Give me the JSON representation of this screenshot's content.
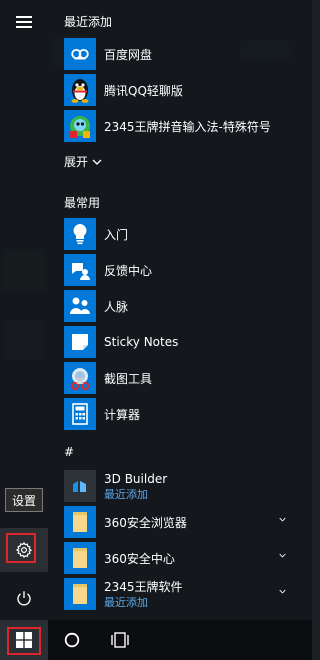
{
  "menu": {
    "recent_header": "最近添加",
    "recent": [
      {
        "label": "百度网盘",
        "icon": "baidu-netdisk-icon"
      },
      {
        "label": "腾讯QQ轻聊版",
        "icon": "qq-penguin-icon"
      },
      {
        "label": "2345王牌拼音输入法-特殊符号",
        "icon": "input-method-icon"
      }
    ],
    "expand_label": "展开",
    "frequent_header": "最常用",
    "frequent": [
      {
        "label": "入门",
        "icon": "lightbulb-icon"
      },
      {
        "label": "反馈中心",
        "icon": "feedback-icon"
      },
      {
        "label": "人脉",
        "icon": "people-icon"
      },
      {
        "label": "Sticky Notes",
        "icon": "sticky-note-icon"
      },
      {
        "label": "截图工具",
        "icon": "snipping-tool-icon"
      },
      {
        "label": "计算器",
        "icon": "calculator-icon"
      }
    ],
    "alpha_header": "#",
    "alpha": [
      {
        "label": "3D Builder",
        "sub": "最近添加",
        "icon": "3d-builder-icon"
      },
      {
        "label": "360安全浏览器",
        "icon": "folder-icon"
      },
      {
        "label": "360安全中心",
        "icon": "folder-icon"
      },
      {
        "label": "2345王牌软件",
        "sub": "最近添加",
        "icon": "folder-icon"
      }
    ]
  },
  "rail": {
    "settings_tooltip": "设置"
  },
  "colors": {
    "accent": "#0078d7",
    "highlight": "#e0262a",
    "sub_text": "#5ea7e8"
  }
}
